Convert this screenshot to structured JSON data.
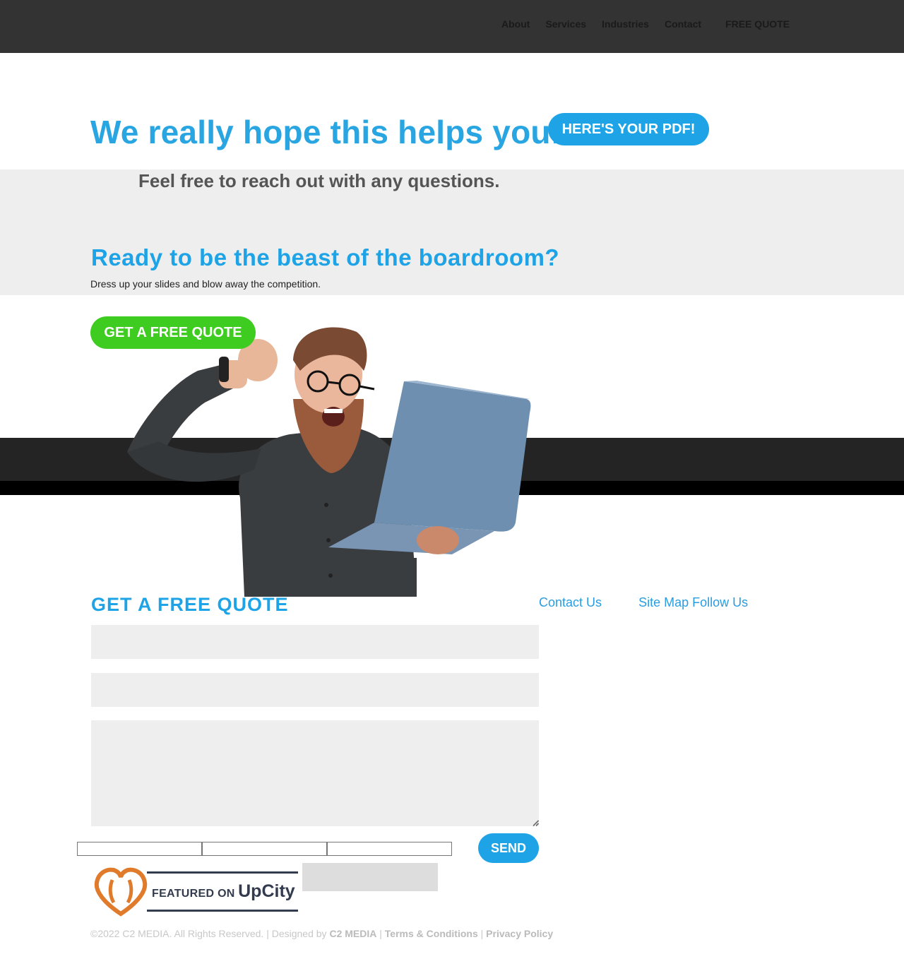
{
  "nav": {
    "items": [
      "About",
      "Services",
      "Industries",
      "Contact"
    ],
    "quote_label": "FREE QUOTE"
  },
  "hero": {
    "title": "We really hope this helps you!",
    "pdf_button": "HERE'S YOUR PDF!",
    "subtitle": "Feel free to reach out with any questions."
  },
  "cta": {
    "heading": "Ready to be the beast of the boardroom?",
    "text": "Dress up your slides and blow away the competition.",
    "button": "GET A FREE QUOTE"
  },
  "quote_form": {
    "heading": "GET A FREE QUOTE",
    "send_label": "SEND"
  },
  "footer": {
    "contact": "Contact Us",
    "sitemap": "Site Map",
    "follow": "Follow Us",
    "copyright": "©2022 C2 MEDIA. All Rights Reserved. | Designed by",
    "designer": "C2 MEDIA",
    "sep": "|",
    "terms": "Terms & Conditions",
    "privacy": "Privacy Policy"
  },
  "badge": {
    "featured": "FEATURED ON",
    "brand": "UpCity"
  },
  "colors": {
    "accent_blue": "#1ea4e6",
    "green": "#3fcc20",
    "topbar": "#333333",
    "upcity_orange": "#e07b2c"
  }
}
